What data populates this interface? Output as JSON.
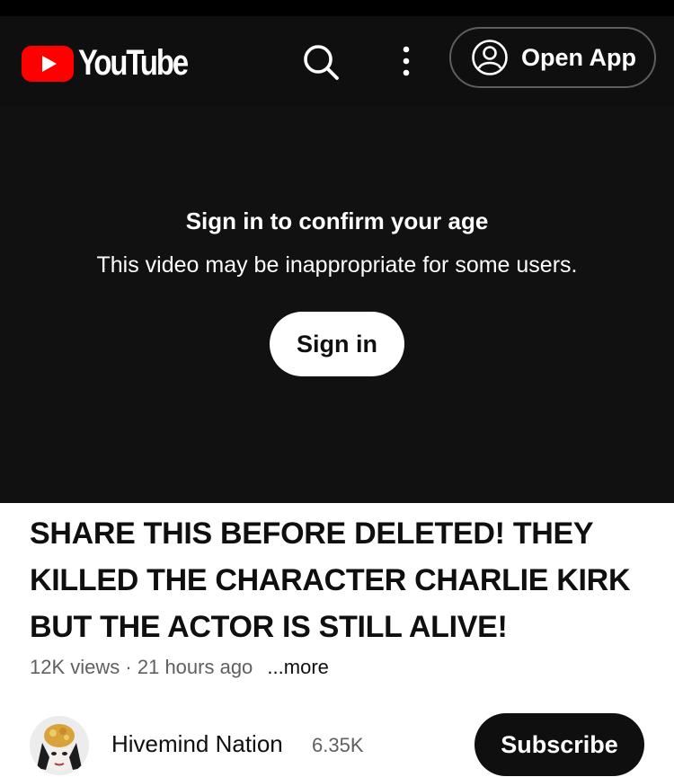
{
  "header": {
    "logo_text": "YouTube",
    "open_app_label": "Open App",
    "icons": [
      "youtube-logo-icon",
      "search-icon",
      "more-vert-icon",
      "account-circle-icon"
    ]
  },
  "player": {
    "title": "Sign in to confirm your age",
    "description": "This video may be inappropriate for some users.",
    "sign_in_label": "Sign in"
  },
  "video": {
    "title": "SHARE THIS BEFORE DELETED! THEY KILLED THE CHARACTER CHARLIE KIRK BUT THE ACTOR IS STILL ALIVE!",
    "views": "12K views",
    "separator": "·",
    "age": "21 hours ago",
    "more_label": "...more"
  },
  "channel": {
    "name": "Hivemind Nation",
    "subscribers": "6.35K",
    "subscribe_label": "Subscribe"
  },
  "colors": {
    "brand_red": "#ff0000",
    "header_bg": "#0f0f0f",
    "player_bg": "#111111",
    "secondary_text": "#606060"
  }
}
